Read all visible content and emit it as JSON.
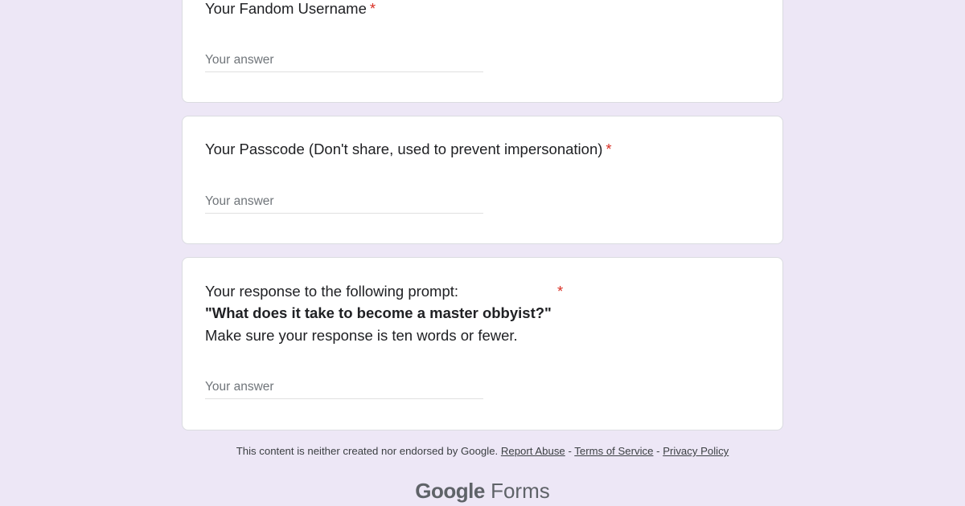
{
  "questions": [
    {
      "title": "Your Fandom Username",
      "required_mark": "*",
      "placeholder": "Your answer",
      "value": ""
    },
    {
      "title": "Your Passcode (Don't share, used to prevent impersonation)",
      "required_mark": "*",
      "placeholder": "Your answer",
      "value": ""
    },
    {
      "title_line1": "Your response to the following prompt:",
      "title_line2": "\"What does it take to become a master obbyist?\"",
      "title_line3": "Make sure your response is ten words or fewer.",
      "required_mark": "*",
      "placeholder": "Your answer",
      "value": ""
    }
  ],
  "footer": {
    "disclaimer": "This content is neither created nor endorsed by Google.",
    "report_abuse": "Report Abuse",
    "sep1": " - ",
    "terms": "Terms of Service",
    "sep2": " - ",
    "privacy": "Privacy Policy"
  },
  "brand": {
    "google": "Google",
    "forms": "Forms"
  },
  "colors": {
    "background": "#ede7f6",
    "required": "#d93025",
    "card": "#ffffff"
  }
}
